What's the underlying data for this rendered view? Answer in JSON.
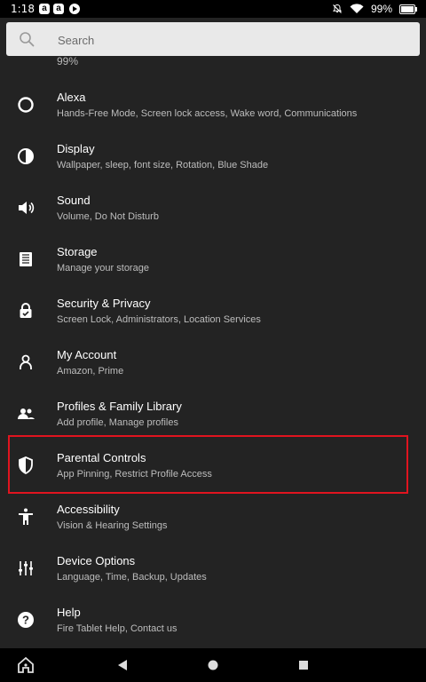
{
  "status_bar": {
    "time": "1:18",
    "battery": "99%",
    "battery_level": 0.99,
    "icons": [
      "amazon-app-icon",
      "amazon-app-icon",
      "play-icon",
      "mute-icon",
      "wifi-icon",
      "battery-icon"
    ]
  },
  "search": {
    "placeholder": "Search"
  },
  "partial_item": {
    "sub": "99%"
  },
  "items": [
    {
      "title": "Alexa",
      "sub": "Hands-Free Mode, Screen lock access, Wake word, Communications",
      "icon": "alexa-icon"
    },
    {
      "title": "Display",
      "sub": "Wallpaper, sleep, font size, Rotation, Blue Shade",
      "icon": "display-contrast-icon"
    },
    {
      "title": "Sound",
      "sub": "Volume, Do Not Disturb",
      "icon": "speaker-icon"
    },
    {
      "title": "Storage",
      "sub": "Manage your storage",
      "icon": "storage-icon"
    },
    {
      "title": "Security & Privacy",
      "sub": "Screen Lock, Administrators, Location Services",
      "icon": "lock-icon"
    },
    {
      "title": "My Account",
      "sub": "Amazon, Prime",
      "icon": "person-icon"
    },
    {
      "title": "Profiles & Family Library",
      "sub": "Add profile, Manage profiles",
      "icon": "people-icon"
    },
    {
      "title": "Parental Controls",
      "sub": "App Pinning, Restrict Profile Access",
      "icon": "shield-icon"
    },
    {
      "title": "Accessibility",
      "sub": "Vision & Hearing Settings",
      "icon": "accessibility-icon"
    },
    {
      "title": "Device Options",
      "sub": "Language, Time, Backup, Updates",
      "icon": "sliders-icon"
    },
    {
      "title": "Help",
      "sub": "Fire Tablet Help, Contact us",
      "icon": "help-icon"
    }
  ],
  "highlight_color": "#e0141f",
  "nav": [
    "home-icon",
    "back-icon",
    "home-circle-icon",
    "recents-icon"
  ]
}
